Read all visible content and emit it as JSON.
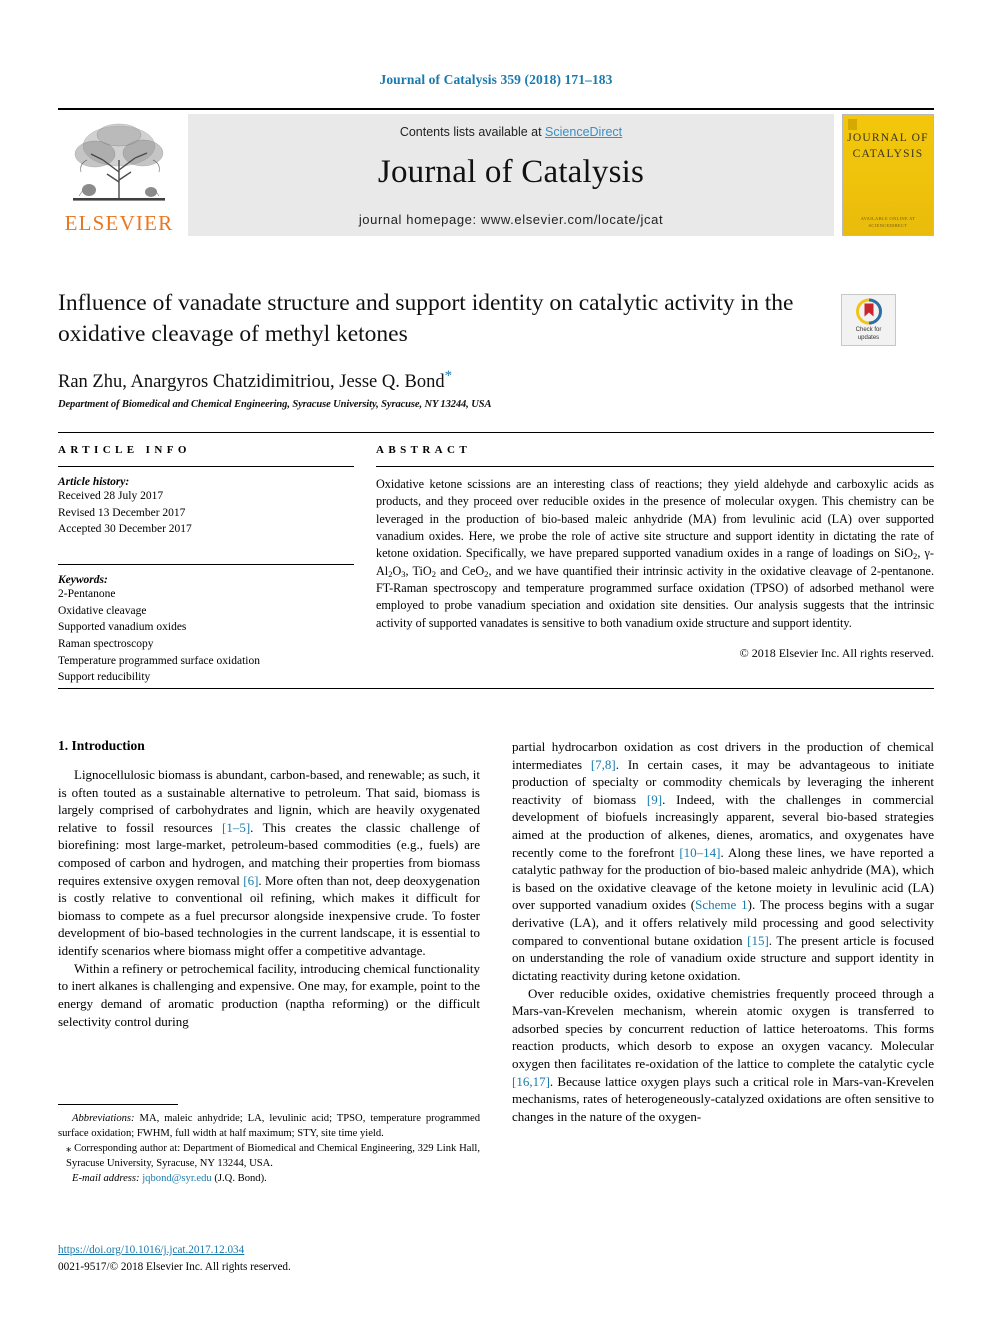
{
  "running_head": "Journal of Catalysis 359 (2018) 171–183",
  "masthead": {
    "contents_prefix": "Contents lists available at ",
    "sciencedirect": "ScienceDirect",
    "journal_title": "Journal of Catalysis",
    "homepage": "journal homepage: www.elsevier.com/locate/jcat",
    "publisher": "ELSEVIER",
    "cover_title": "JOURNAL OF\nCATALYSIS",
    "cover_footer": "AVAILABLE ONLINE AT\nSCIENCEDIRECT"
  },
  "article": {
    "title": "Influence of vanadate structure and support identity on catalytic activity in the oxidative cleavage of methyl ketones",
    "authors": "Ran Zhu, Anargyros Chatzidimitriou, Jesse Q. Bond",
    "corresponding_marker": "*",
    "affiliation": "Department of Biomedical and Chemical Engineering, Syracuse University, Syracuse, NY 13244, USA",
    "crossmark_label": "Check for\nupdates"
  },
  "article_info": {
    "heading": "ARTICLE INFO",
    "history_label": "Article history:",
    "history": [
      "Received 28 July 2017",
      "Revised 13 December 2017",
      "Accepted 30 December 2017"
    ],
    "keywords_label": "Keywords:",
    "keywords": [
      "2-Pentanone",
      "Oxidative cleavage",
      "Supported vanadium oxides",
      "Raman spectroscopy",
      "Temperature programmed surface oxidation",
      "Support reducibility"
    ]
  },
  "abstract": {
    "heading": "ABSTRACT",
    "text_part1": "Oxidative ketone scissions are an interesting class of reactions; they yield aldehyde and carboxylic acids as products, and they proceed over reducible oxides in the presence of molecular oxygen. This chemistry can be leveraged in the production of bio-based maleic anhydride (MA) from levulinic acid (LA) over supported vanadium oxides. Here, we probe the role of active site structure and support identity in dictating the rate of ketone oxidation. Specifically, we have prepared supported vanadium oxides in a range of loadings on SiO",
    "sub1": "2",
    "text_part2": ", γ-Al",
    "sub2": "2",
    "text_part3": "O",
    "sub3": "3",
    "text_part4": ", TiO",
    "sub4": "2",
    "text_part5": " and CeO",
    "sub5": "2",
    "text_part6": ", and we have quantified their intrinsic activity in the oxidative cleavage of 2-pentanone. FT-Raman spectroscopy and temperature programmed surface oxidation (TPSO) of adsorbed methanol were employed to probe vanadium speciation and oxidation site densities. Our analysis suggests that the intrinsic activity of supported vanadates is sensitive to both vanadium oxide structure and support identity.",
    "copyright": "© 2018 Elsevier Inc. All rights reserved."
  },
  "body": {
    "section_title": "1. Introduction",
    "left_paragraphs": [
      {
        "segments": [
          {
            "t": "Lignocellulosic biomass is abundant, carbon-based, and renewable; as such, it is often touted as a sustainable alternative to petroleum. That said, biomass is largely comprised of carbohydrates and lignin, which are heavily oxygenated relative to fossil resources ",
            "k": "text"
          },
          {
            "t": "[1–5]",
            "k": "ref"
          },
          {
            "t": ". This creates the classic challenge of biorefining: most large-market, petroleum-based commodities (e.g., fuels) are composed of carbon and hydrogen, and matching their properties from biomass requires extensive oxygen removal ",
            "k": "text"
          },
          {
            "t": "[6]",
            "k": "ref"
          },
          {
            "t": ". More often than not, deep deoxygenation is costly relative to conventional oil refining, which makes it difficult for biomass to compete as a fuel precursor alongside inexpensive crude. To foster development of bio-based technologies in the current landscape, it is essential to identify scenarios where biomass might offer a competitive advantage.",
            "k": "text"
          }
        ]
      },
      {
        "segments": [
          {
            "t": "Within a refinery or petrochemical facility, introducing chemical functionality to inert alkanes is challenging and expensive. One may, for example, point to the energy demand of aromatic production (naptha reforming) or the difficult selectivity control during",
            "k": "text"
          }
        ]
      }
    ],
    "right_paragraphs": [
      {
        "segments": [
          {
            "t": "partial hydrocarbon oxidation as cost drivers in the production of chemical intermediates ",
            "k": "text"
          },
          {
            "t": "[7,8]",
            "k": "ref"
          },
          {
            "t": ". In certain cases, it may be advantageous to initiate production of specialty or commodity chemicals by leveraging the inherent reactivity of biomass ",
            "k": "text"
          },
          {
            "t": "[9]",
            "k": "ref"
          },
          {
            "t": ". Indeed, with the challenges in commercial development of biofuels increasingly apparent, several bio-based strategies aimed at the production of alkenes, dienes, aromatics, and oxygenates have recently come to the forefront ",
            "k": "text"
          },
          {
            "t": "[10–14]",
            "k": "ref"
          },
          {
            "t": ". Along these lines, we have reported a catalytic pathway for the production of bio-based maleic anhydride (MA), which is based on the oxidative cleavage of the ketone moiety in levulinic acid (LA) over supported vanadium oxides (",
            "k": "text"
          },
          {
            "t": "Scheme 1",
            "k": "ref"
          },
          {
            "t": "). The process begins with a sugar derivative (LA), and it offers relatively mild processing and good selectivity compared to conventional butane oxidation ",
            "k": "text"
          },
          {
            "t": "[15]",
            "k": "ref"
          },
          {
            "t": ". The present article is focused on understanding the role of vanadium oxide structure and support identity in dictating reactivity during ketone oxidation.",
            "k": "text"
          }
        ]
      },
      {
        "segments": [
          {
            "t": "Over reducible oxides, oxidative chemistries frequently proceed through a Mars-van-Krevelen mechanism, wherein atomic oxygen is transferred to adsorbed species by concurrent reduction of lattice heteroatoms. This forms reaction products, which desorb to expose an oxygen vacancy. Molecular oxygen then facilitates re-oxidation of the lattice to complete the catalytic cycle ",
            "k": "text"
          },
          {
            "t": "[16,17]",
            "k": "ref"
          },
          {
            "t": ". Because lattice oxygen plays such a critical role in Mars-van-Krevelen mechanisms, rates of heterogeneously-catalyzed oxidations are often sensitive to changes in the nature of the oxygen-",
            "k": "text"
          }
        ]
      }
    ]
  },
  "footnotes": {
    "abbreviations_label": "Abbreviations:",
    "abbreviations_text": " MA, maleic anhydride; LA, levulinic acid; TPSO, temperature programmed surface oxidation; FWHM, full width at half maximum; STY, site time yield.",
    "corresponding_marker": "⁎",
    "corresponding_text": " Corresponding author at: Department of Biomedical and Chemical Engineering, 329 Link Hall, Syracuse University, Syracuse, NY 13244, USA.",
    "email_label": "E-mail address:",
    "email": "jqbond@syr.edu",
    "email_suffix": " (J.Q. Bond)."
  },
  "doi": {
    "url": "https://doi.org/10.1016/j.jcat.2017.12.034",
    "issn_line": "0021-9517/© 2018 Elsevier Inc. All rights reserved."
  },
  "colors": {
    "link": "#1a7aad",
    "sciencedirect": "#3a8fc4",
    "elsevier_orange": "#E87722",
    "cover_yellow": "#f1c40f"
  }
}
